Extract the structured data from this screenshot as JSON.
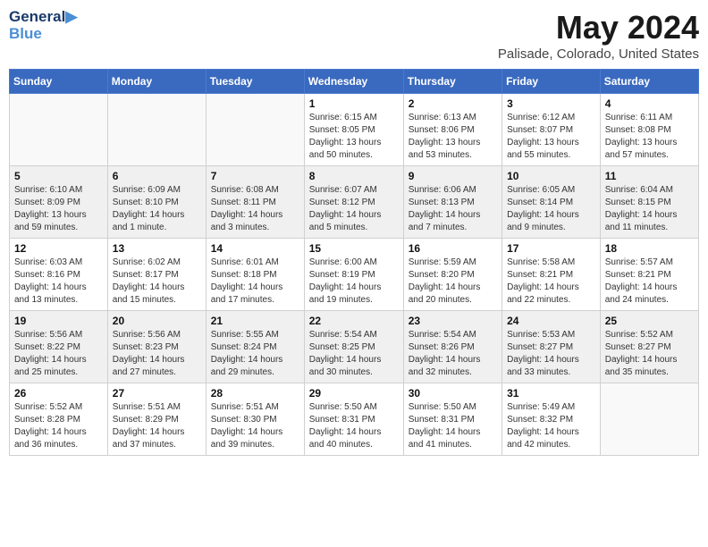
{
  "header": {
    "logo_line1": "General",
    "logo_line2": "Blue",
    "month_title": "May 2024",
    "location": "Palisade, Colorado, United States"
  },
  "days_of_week": [
    "Sunday",
    "Monday",
    "Tuesday",
    "Wednesday",
    "Thursday",
    "Friday",
    "Saturday"
  ],
  "weeks": [
    [
      {
        "day": "",
        "sunrise": "",
        "sunset": "",
        "daylight": ""
      },
      {
        "day": "",
        "sunrise": "",
        "sunset": "",
        "daylight": ""
      },
      {
        "day": "",
        "sunrise": "",
        "sunset": "",
        "daylight": ""
      },
      {
        "day": "1",
        "sunrise": "Sunrise: 6:15 AM",
        "sunset": "Sunset: 8:05 PM",
        "daylight": "Daylight: 13 hours and 50 minutes."
      },
      {
        "day": "2",
        "sunrise": "Sunrise: 6:13 AM",
        "sunset": "Sunset: 8:06 PM",
        "daylight": "Daylight: 13 hours and 53 minutes."
      },
      {
        "day": "3",
        "sunrise": "Sunrise: 6:12 AM",
        "sunset": "Sunset: 8:07 PM",
        "daylight": "Daylight: 13 hours and 55 minutes."
      },
      {
        "day": "4",
        "sunrise": "Sunrise: 6:11 AM",
        "sunset": "Sunset: 8:08 PM",
        "daylight": "Daylight: 13 hours and 57 minutes."
      }
    ],
    [
      {
        "day": "5",
        "sunrise": "Sunrise: 6:10 AM",
        "sunset": "Sunset: 8:09 PM",
        "daylight": "Daylight: 13 hours and 59 minutes."
      },
      {
        "day": "6",
        "sunrise": "Sunrise: 6:09 AM",
        "sunset": "Sunset: 8:10 PM",
        "daylight": "Daylight: 14 hours and 1 minute."
      },
      {
        "day": "7",
        "sunrise": "Sunrise: 6:08 AM",
        "sunset": "Sunset: 8:11 PM",
        "daylight": "Daylight: 14 hours and 3 minutes."
      },
      {
        "day": "8",
        "sunrise": "Sunrise: 6:07 AM",
        "sunset": "Sunset: 8:12 PM",
        "daylight": "Daylight: 14 hours and 5 minutes."
      },
      {
        "day": "9",
        "sunrise": "Sunrise: 6:06 AM",
        "sunset": "Sunset: 8:13 PM",
        "daylight": "Daylight: 14 hours and 7 minutes."
      },
      {
        "day": "10",
        "sunrise": "Sunrise: 6:05 AM",
        "sunset": "Sunset: 8:14 PM",
        "daylight": "Daylight: 14 hours and 9 minutes."
      },
      {
        "day": "11",
        "sunrise": "Sunrise: 6:04 AM",
        "sunset": "Sunset: 8:15 PM",
        "daylight": "Daylight: 14 hours and 11 minutes."
      }
    ],
    [
      {
        "day": "12",
        "sunrise": "Sunrise: 6:03 AM",
        "sunset": "Sunset: 8:16 PM",
        "daylight": "Daylight: 14 hours and 13 minutes."
      },
      {
        "day": "13",
        "sunrise": "Sunrise: 6:02 AM",
        "sunset": "Sunset: 8:17 PM",
        "daylight": "Daylight: 14 hours and 15 minutes."
      },
      {
        "day": "14",
        "sunrise": "Sunrise: 6:01 AM",
        "sunset": "Sunset: 8:18 PM",
        "daylight": "Daylight: 14 hours and 17 minutes."
      },
      {
        "day": "15",
        "sunrise": "Sunrise: 6:00 AM",
        "sunset": "Sunset: 8:19 PM",
        "daylight": "Daylight: 14 hours and 19 minutes."
      },
      {
        "day": "16",
        "sunrise": "Sunrise: 5:59 AM",
        "sunset": "Sunset: 8:20 PM",
        "daylight": "Daylight: 14 hours and 20 minutes."
      },
      {
        "day": "17",
        "sunrise": "Sunrise: 5:58 AM",
        "sunset": "Sunset: 8:21 PM",
        "daylight": "Daylight: 14 hours and 22 minutes."
      },
      {
        "day": "18",
        "sunrise": "Sunrise: 5:57 AM",
        "sunset": "Sunset: 8:21 PM",
        "daylight": "Daylight: 14 hours and 24 minutes."
      }
    ],
    [
      {
        "day": "19",
        "sunrise": "Sunrise: 5:56 AM",
        "sunset": "Sunset: 8:22 PM",
        "daylight": "Daylight: 14 hours and 25 minutes."
      },
      {
        "day": "20",
        "sunrise": "Sunrise: 5:56 AM",
        "sunset": "Sunset: 8:23 PM",
        "daylight": "Daylight: 14 hours and 27 minutes."
      },
      {
        "day": "21",
        "sunrise": "Sunrise: 5:55 AM",
        "sunset": "Sunset: 8:24 PM",
        "daylight": "Daylight: 14 hours and 29 minutes."
      },
      {
        "day": "22",
        "sunrise": "Sunrise: 5:54 AM",
        "sunset": "Sunset: 8:25 PM",
        "daylight": "Daylight: 14 hours and 30 minutes."
      },
      {
        "day": "23",
        "sunrise": "Sunrise: 5:54 AM",
        "sunset": "Sunset: 8:26 PM",
        "daylight": "Daylight: 14 hours and 32 minutes."
      },
      {
        "day": "24",
        "sunrise": "Sunrise: 5:53 AM",
        "sunset": "Sunset: 8:27 PM",
        "daylight": "Daylight: 14 hours and 33 minutes."
      },
      {
        "day": "25",
        "sunrise": "Sunrise: 5:52 AM",
        "sunset": "Sunset: 8:27 PM",
        "daylight": "Daylight: 14 hours and 35 minutes."
      }
    ],
    [
      {
        "day": "26",
        "sunrise": "Sunrise: 5:52 AM",
        "sunset": "Sunset: 8:28 PM",
        "daylight": "Daylight: 14 hours and 36 minutes."
      },
      {
        "day": "27",
        "sunrise": "Sunrise: 5:51 AM",
        "sunset": "Sunset: 8:29 PM",
        "daylight": "Daylight: 14 hours and 37 minutes."
      },
      {
        "day": "28",
        "sunrise": "Sunrise: 5:51 AM",
        "sunset": "Sunset: 8:30 PM",
        "daylight": "Daylight: 14 hours and 39 minutes."
      },
      {
        "day": "29",
        "sunrise": "Sunrise: 5:50 AM",
        "sunset": "Sunset: 8:31 PM",
        "daylight": "Daylight: 14 hours and 40 minutes."
      },
      {
        "day": "30",
        "sunrise": "Sunrise: 5:50 AM",
        "sunset": "Sunset: 8:31 PM",
        "daylight": "Daylight: 14 hours and 41 minutes."
      },
      {
        "day": "31",
        "sunrise": "Sunrise: 5:49 AM",
        "sunset": "Sunset: 8:32 PM",
        "daylight": "Daylight: 14 hours and 42 minutes."
      },
      {
        "day": "",
        "sunrise": "",
        "sunset": "",
        "daylight": ""
      }
    ]
  ]
}
